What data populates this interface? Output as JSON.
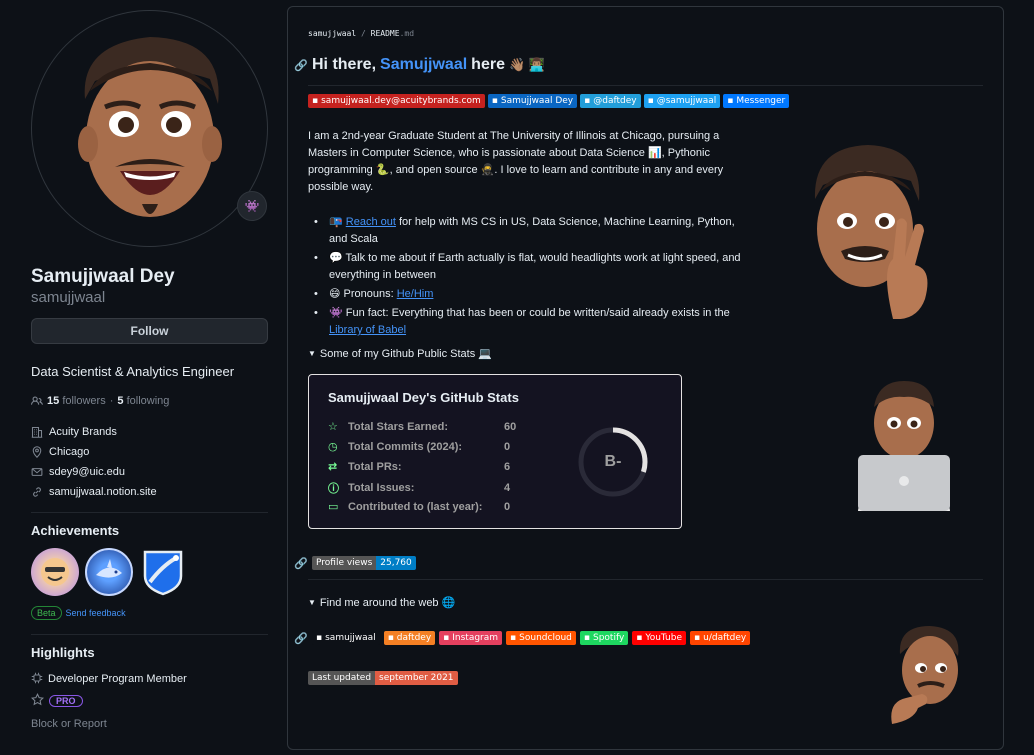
{
  "profile": {
    "name": "Samujjwaal Dey",
    "login": "samujjwaal",
    "follow_label": "Follow",
    "bio": "Data Scientist & Analytics Engineer",
    "followers_count": "15",
    "followers_label": "followers",
    "following_count": "5",
    "following_label": "following",
    "company": "Acuity Brands",
    "location": "Chicago",
    "email": "sdey9@uic.edu",
    "website": "samujjwaal.notion.site"
  },
  "achievements": {
    "title": "Achievements",
    "beta": "Beta",
    "feedback": "Send feedback"
  },
  "highlights": {
    "title": "Highlights",
    "program": "Developer Program Member",
    "pro": "PRO",
    "block": "Block or Report"
  },
  "readme": {
    "crumb_user": "samujjwaal",
    "crumb_sep": "/",
    "crumb_file": "README",
    "crumb_ext": ".md",
    "heading_pre": "Hi there,",
    "heading_name": "Samujjwaal",
    "heading_post": "here",
    "heading_emoji": "👋🏽 👨🏽‍💻",
    "contact_badges": [
      {
        "label": "samujjwaal.dey@acuitybrands.com",
        "color": "#c5221f",
        "icon": "gmail-icon"
      },
      {
        "label": "Samujjwaal Dey",
        "color": "#0a66c2",
        "icon": "linkedin-icon"
      },
      {
        "label": "@daftdey",
        "color": "#229ed9",
        "icon": "telegram-icon"
      },
      {
        "label": "@samujjwaal",
        "color": "#1da1f2",
        "icon": "twitter-icon"
      },
      {
        "label": "Messenger",
        "color": "#0078ff",
        "icon": "messenger-icon"
      }
    ],
    "intro_1": "I am a 2nd-year Graduate Student at The University of Illinois at Chicago, pursuing a Masters in Computer Science, who is passionate about Data Science",
    "intro_2": ", Pythonic programming",
    "intro_3": ", and open source",
    "intro_4": ". I love to learn and contribute in any and every possible way.",
    "bullet1_emoji": "📭",
    "bullet1_link": "Reach out",
    "bullet1_text": " for help with MS CS in US, Data Science, Machine Learning, Python, and Scala",
    "bullet2": "💬 Talk to me about if Earth actually is flat, would headlights work at light speed, and everything in between",
    "bullet3_text": "😄 Pronouns: ",
    "bullet3_link": "He/Him",
    "bullet4_text": "👾 Fun fact: Everything that has been or could be written/said already exists in the ",
    "bullet4_link": "Library of Babel",
    "stats_summary": "Some of my Github Public Stats 💻",
    "find_summary": "Find me around the web 🌐"
  },
  "stats": {
    "title": "Samujjwaal Dey's GitHub Stats",
    "grade": "B-",
    "grade_progress": 0.3,
    "rows": [
      {
        "label": "Total Stars Earned:",
        "value": "60",
        "icon": "star-icon"
      },
      {
        "label": "Total Commits (2024):",
        "value": "0",
        "icon": "history-icon"
      },
      {
        "label": "Total PRs:",
        "value": "6",
        "icon": "pr-icon"
      },
      {
        "label": "Total Issues:",
        "value": "4",
        "icon": "issue-icon"
      },
      {
        "label": "Contributed to (last year):",
        "value": "0",
        "icon": "repo-icon"
      }
    ]
  },
  "views": {
    "label": "Profile views",
    "value": "25,760"
  },
  "socials": [
    {
      "label": "samujjwaal",
      "color": "#0d1117",
      "icon": "dev-icon"
    },
    {
      "label": "daftdey",
      "color": "#f48024",
      "icon": "stackoverflow-icon"
    },
    {
      "label": "Instagram",
      "color": "#e4405f",
      "icon": "instagram-icon"
    },
    {
      "label": "Soundcloud",
      "color": "#ff5500",
      "icon": "soundcloud-icon"
    },
    {
      "label": "Spotify",
      "color": "#1ed760",
      "icon": "spotify-icon"
    },
    {
      "label": "YouTube",
      "color": "#ff0000",
      "icon": "youtube-icon"
    },
    {
      "label": "u/daftdey",
      "color": "#ff4500",
      "icon": "reddit-icon"
    }
  ],
  "updated": {
    "label": "Last updated",
    "value": "september 2021"
  }
}
